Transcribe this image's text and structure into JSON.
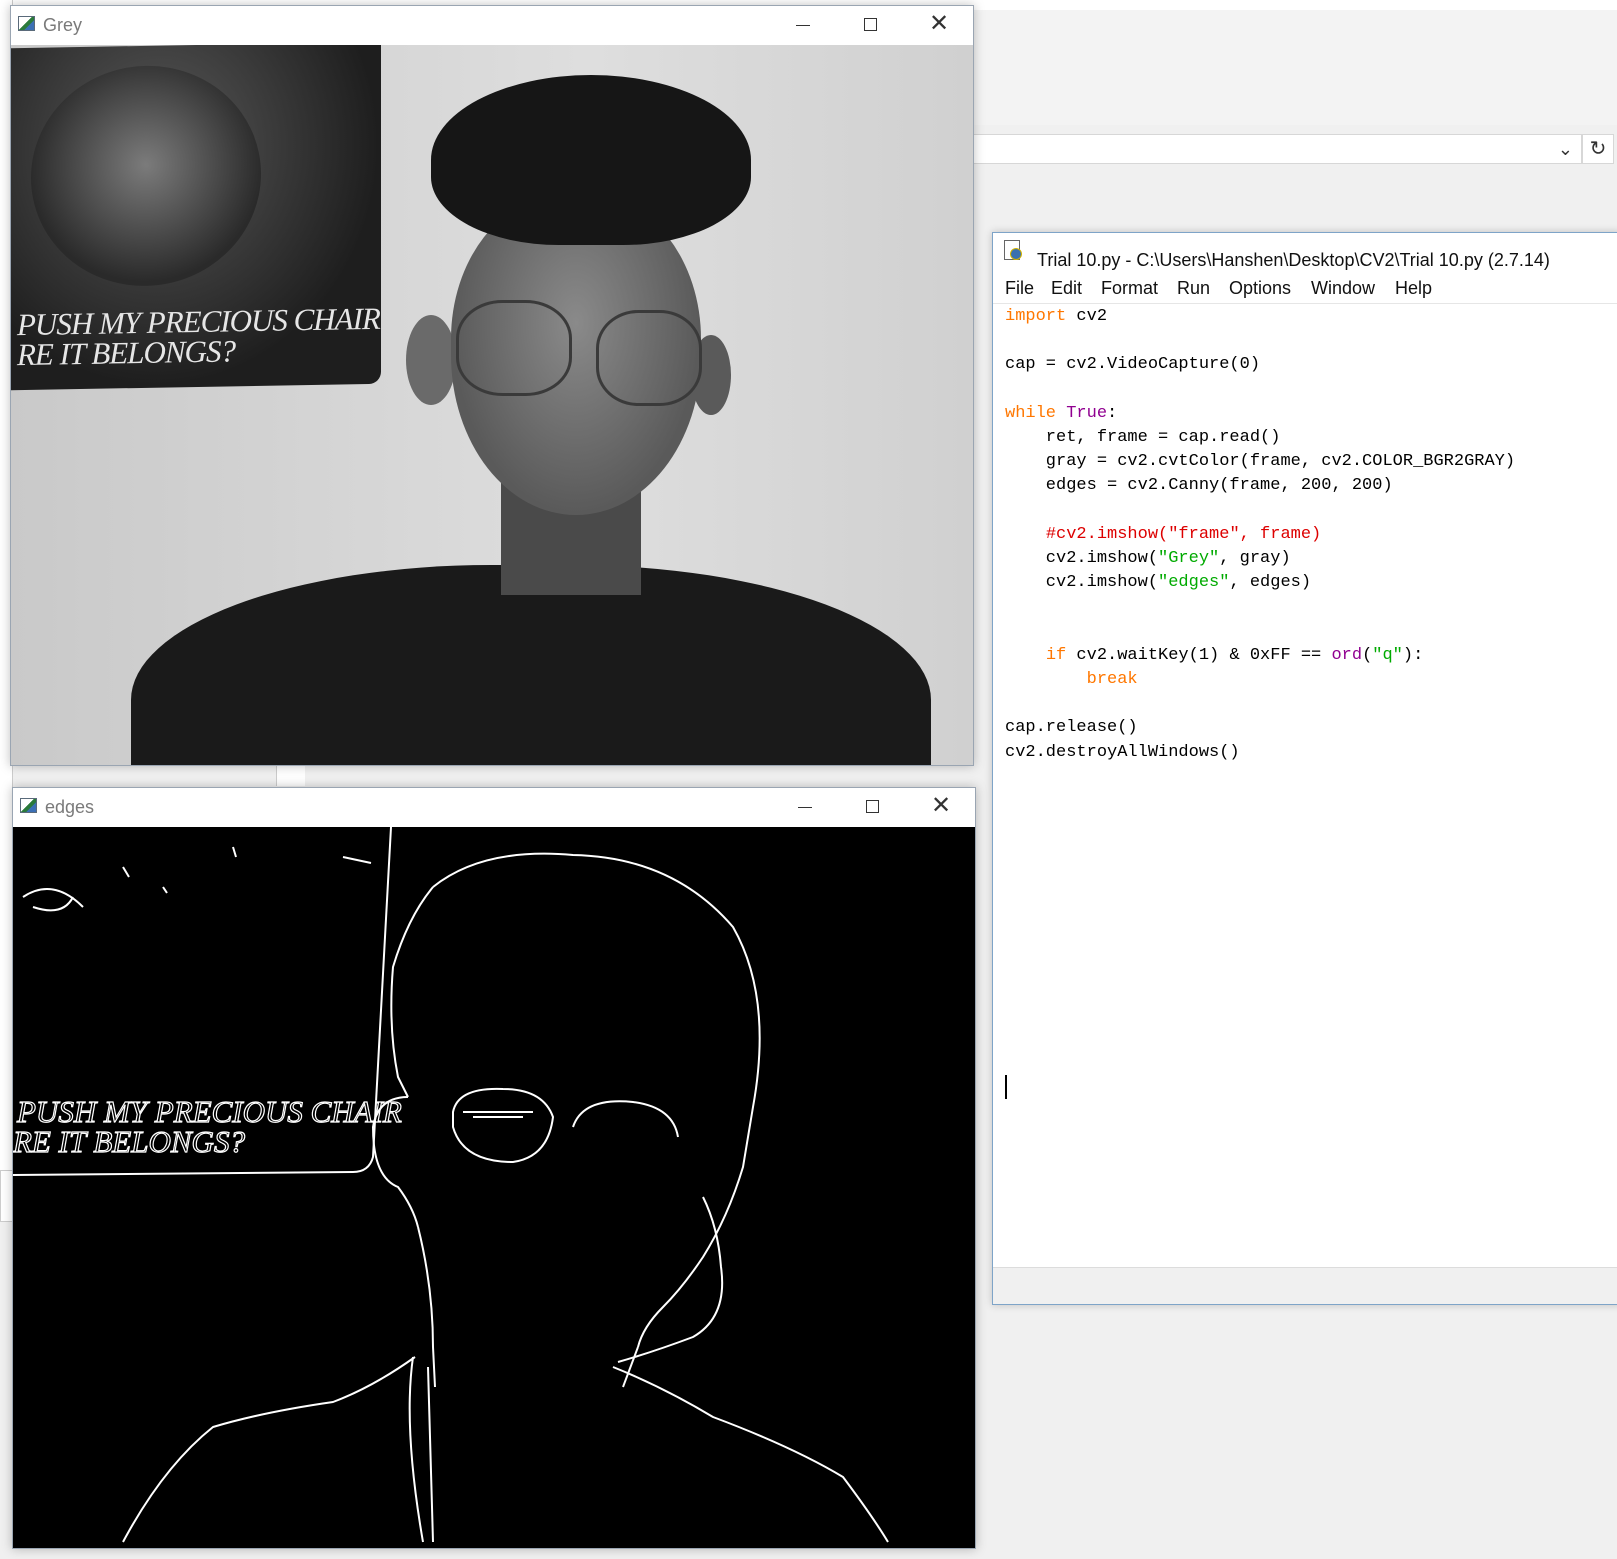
{
  "windows": {
    "grey": {
      "title": "Grey"
    },
    "edges": {
      "title": "edges"
    }
  },
  "poster": {
    "line1": "PUSH MY PRECIOUS CHAIR",
    "line2": "RE IT BELONGS?"
  },
  "idle": {
    "title": "Trial 10.py - C:\\Users\\Hanshen\\Desktop\\CV2\\Trial 10.py (2.7.14)",
    "menu": [
      "File",
      "Edit",
      "Format",
      "Run",
      "Options",
      "Window",
      "Help"
    ],
    "code_lines": [
      "import cv2",
      "",
      "cap = cv2.VideoCapture(0)",
      "",
      "while True:",
      "    ret, frame = cap.read()",
      "    gray = cv2.cvtColor(frame, cv2.COLOR_BGR2GRAY)",
      "    edges = cv2.Canny(frame, 200, 200)",
      "",
      "    #cv2.imshow(\"frame\", frame)",
      "    cv2.imshow(\"Grey\", gray)",
      "    cv2.imshow(\"edges\", edges)",
      "",
      "",
      "    if cv2.waitKey(1) & 0xFF == ord(\"q\"):",
      "        break",
      "",
      "cap.release()",
      "cv2.destroyAllWindows()"
    ]
  },
  "colors": {
    "keyword": "#ff7700",
    "builtin": "#900090",
    "string": "#00aa00",
    "comment": "#dd0000"
  }
}
